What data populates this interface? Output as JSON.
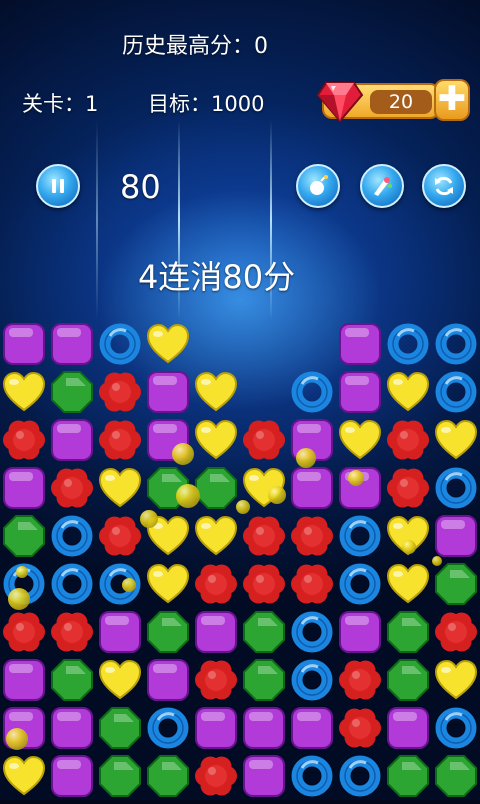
{
  "hud": {
    "best_score": "历史最高分：0",
    "level": "关卡：1",
    "target": "目标：1000",
    "score": "80",
    "combo": "4连消80分"
  },
  "gems": {
    "count": "20",
    "plus": "✚"
  },
  "buttons": {
    "pause": "pause-icon",
    "bomb": "bomb-icon",
    "paint": "paint-icon",
    "refresh": "refresh-icon"
  },
  "colors": {
    "purple": "#b23ad8",
    "green": "#2ca532",
    "blue": "#1b86df",
    "yellow": "#f7e32d",
    "red": "#d5201f"
  },
  "board": {
    "rows": [
      [
        "P",
        "P",
        "B",
        "Y",
        "",
        "",
        "",
        "P",
        "B",
        "B"
      ],
      [
        "Y",
        "G",
        "R",
        "P",
        "Y",
        "",
        "B",
        "P",
        "Y",
        "B"
      ],
      [
        "R",
        "P",
        "R",
        "P",
        "Y",
        "R",
        "P",
        "Y",
        "R",
        "Y"
      ],
      [
        "P",
        "R",
        "Y",
        "G",
        "G",
        "Y",
        "P",
        "P",
        "R",
        "B"
      ],
      [
        "G",
        "B",
        "R",
        "Y",
        "Y",
        "R",
        "R",
        "B",
        "Y",
        "P"
      ],
      [
        "B",
        "B",
        "B",
        "Y",
        "R",
        "R",
        "R",
        "B",
        "Y",
        "G"
      ],
      [
        "R",
        "R",
        "P",
        "G",
        "P",
        "G",
        "B",
        "P",
        "G",
        "R"
      ],
      [
        "P",
        "G",
        "Y",
        "P",
        "R",
        "G",
        "B",
        "R",
        "G",
        "Y"
      ],
      [
        "P",
        "P",
        "G",
        "B",
        "P",
        "P",
        "P",
        "R",
        "P",
        "B"
      ],
      [
        "Y",
        "P",
        "G",
        "G",
        "R",
        "P",
        "B",
        "B",
        "G",
        "G"
      ]
    ]
  }
}
